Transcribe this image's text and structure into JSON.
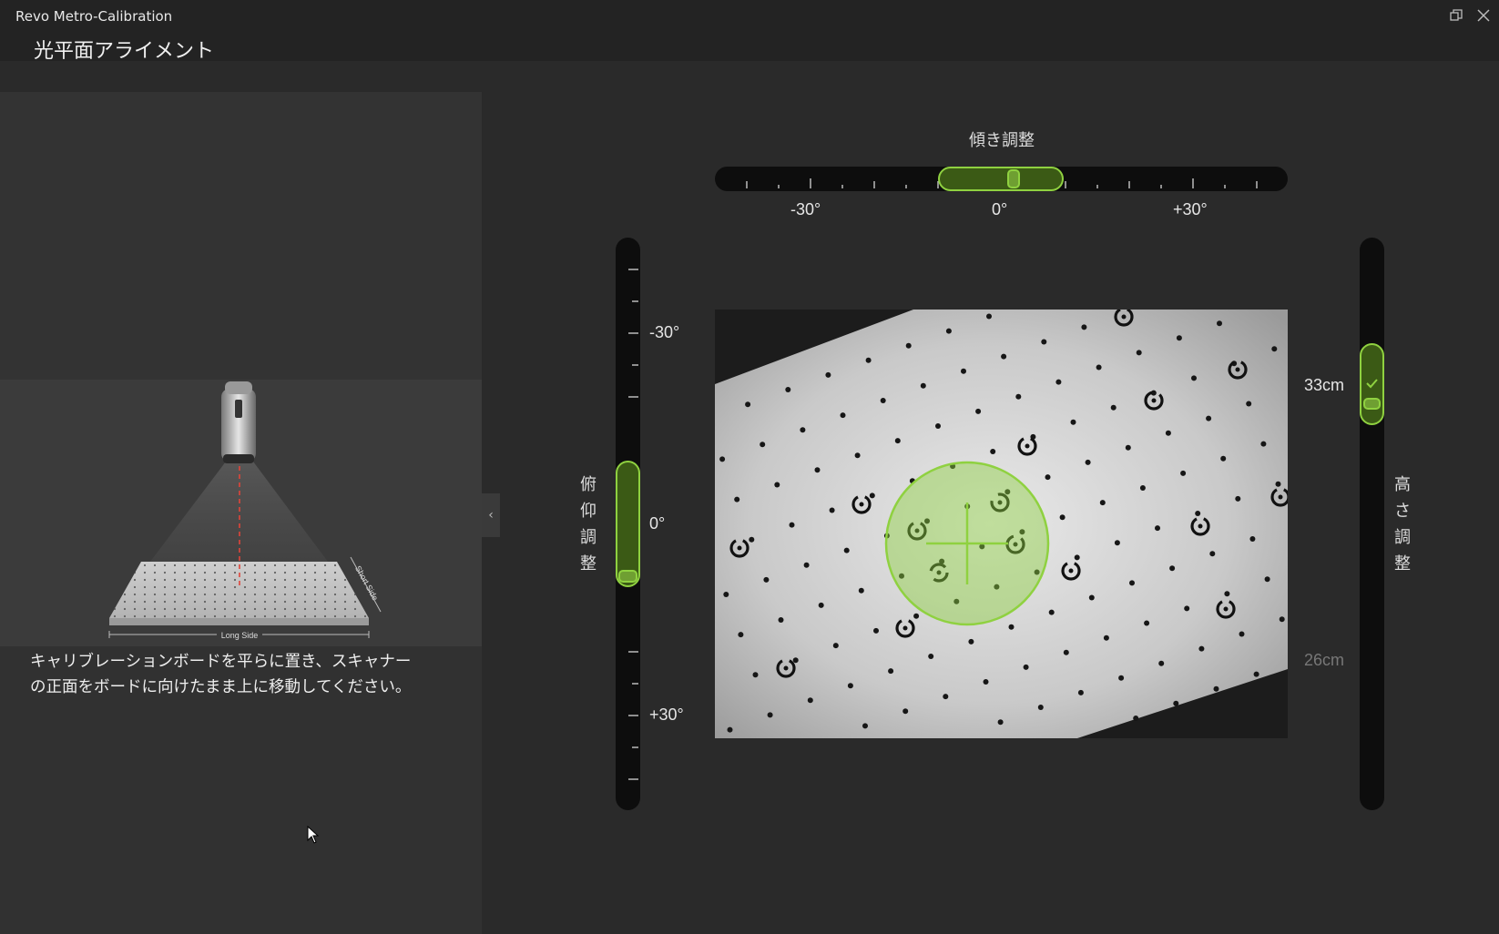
{
  "window": {
    "app_title": "Revo Metro-Calibration",
    "page_title": "光平面アライメント",
    "restore_icon": "restore-window-icon",
    "close_icon": "close-icon"
  },
  "illustration": {
    "long_side_label": "Long Side",
    "short_side_label": "Short Side"
  },
  "instruction": {
    "line1": "キャリブレーションボードを平らに置き、スキャナー",
    "line2": "の正面をボードに向けたまま上に移動してください。"
  },
  "tilt": {
    "title": "傾き調整",
    "labels": [
      "-30°",
      "0°",
      "+30°"
    ],
    "range": [
      -45,
      45
    ],
    "value": 2,
    "accent": "#8fd140"
  },
  "pitch": {
    "title_chars": [
      "俯",
      "仰",
      "調",
      "整"
    ],
    "labels": [
      "-30°",
      "0°",
      "+30°"
    ],
    "range": [
      -45,
      45
    ],
    "value": 0
  },
  "height": {
    "title_chars": [
      "高",
      "さ",
      "調",
      "整"
    ],
    "current_label": "33cm",
    "min_label": "26cm",
    "status_icon": "check-icon"
  },
  "colors": {
    "accent": "#8fd140",
    "accent_fill": "#3b5a15"
  }
}
